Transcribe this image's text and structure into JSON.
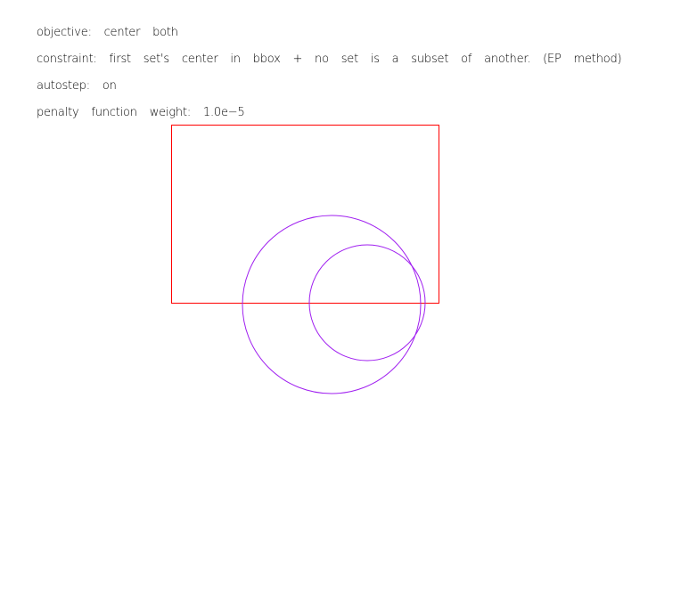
{
  "info": {
    "objective": "objective:  center  both",
    "constraint": "constraint:  first  set's  center  in  bbox  +  no  set  is  a  subset  of  another.  (EP  method)",
    "autostep": "autostep:  on",
    "penalty": "penalty  function  weight:  1.0e−5"
  },
  "colors": {
    "bbox": "#ff0000",
    "circles": "#a020f0",
    "text": "#000000",
    "background": "#ffffff"
  },
  "shapes": {
    "bbox": "bounding-box",
    "sets": [
      "set-circle-large",
      "set-circle-small"
    ]
  }
}
